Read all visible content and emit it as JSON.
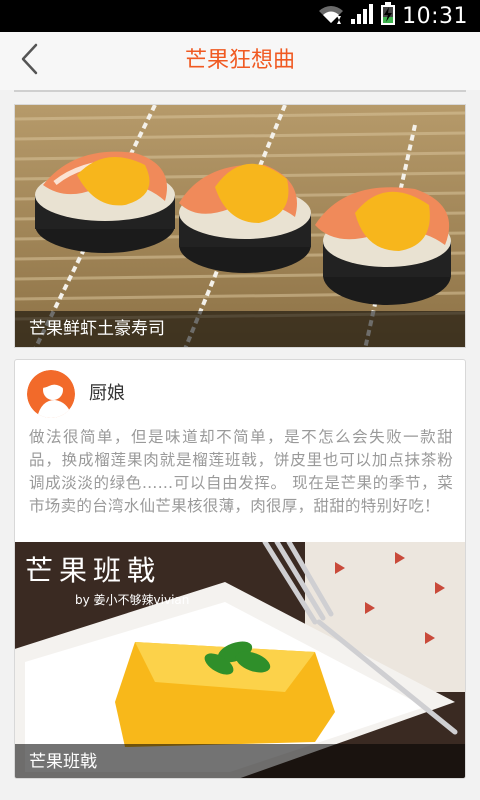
{
  "status_bar": {
    "time": "10:31",
    "icons": [
      "wifi-icon",
      "signal-icon",
      "battery-charging-icon"
    ]
  },
  "header": {
    "title": "芒果狂想曲",
    "back_icon": "chevron-left-icon"
  },
  "colors": {
    "accent": "#f05a22",
    "background": "#f2f2f2",
    "status_bar": "#000000"
  },
  "recipe_card": {
    "caption": "芒果鲜虾土豪寿司"
  },
  "post_card": {
    "author": "厨娘",
    "description": "做法很简单，但是味道却不简单，是不怎么会失败一款甜品，换成榴莲果肉就是榴莲班戟，饼皮里也可以加点抹茶粉调成淡淡的绿色……可以自由发挥。 现在是芒果的季节，菜市场卖的台湾水仙芒果核很薄，肉很厚，甜甜的特别好吃！",
    "photo_overlay_title": "芒果班戟",
    "photo_overlay_byline": "by 姜小不够辣vivian",
    "caption": "芒果班戟"
  }
}
